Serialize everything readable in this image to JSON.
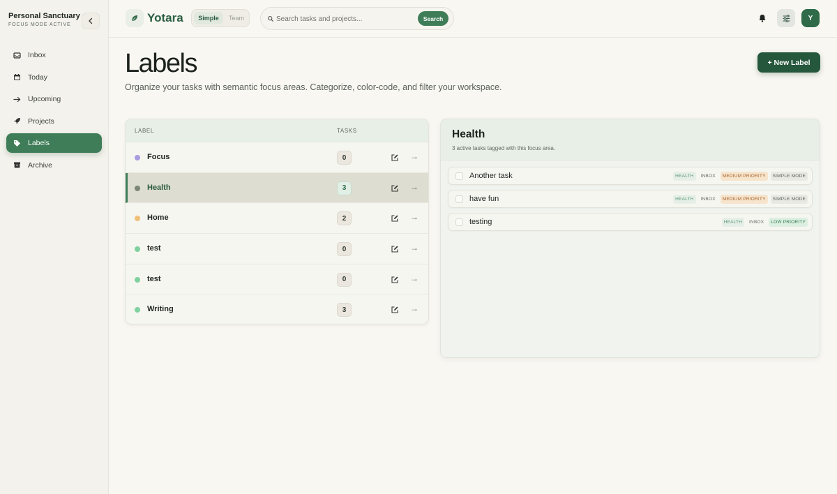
{
  "sidebar": {
    "workspace_name": "Personal Sanctuary",
    "workspace_status": "FOCUS MODE ACTIVE",
    "items": [
      {
        "label": "Inbox",
        "icon": "inbox-icon"
      },
      {
        "label": "Today",
        "icon": "calendar-icon"
      },
      {
        "label": "Upcoming",
        "icon": "arrow-right-icon"
      },
      {
        "label": "Projects",
        "icon": "rocket-icon"
      },
      {
        "label": "Labels",
        "icon": "tag-icon",
        "active": true
      },
      {
        "label": "Archive",
        "icon": "archive-icon"
      }
    ]
  },
  "header": {
    "brand": "Yotara",
    "mode_simple": "Simple",
    "mode_team": "Team",
    "search_placeholder": "Search tasks and projects...",
    "search_button": "Search",
    "avatar_initial": "Y"
  },
  "main": {
    "title": "Labels",
    "subtitle": "Organize your tasks with semantic focus areas. Categorize, color-code, and filter your workspace.",
    "new_label_button": "+ New Label",
    "table": {
      "col_label": "LABEL",
      "col_tasks": "TASKS",
      "rows": [
        {
          "name": "Focus",
          "count": "0",
          "color": "#a99be0"
        },
        {
          "name": "Health",
          "count": "3",
          "color": "#7d8779",
          "selected": true
        },
        {
          "name": "Home",
          "count": "2",
          "color": "#efc07a"
        },
        {
          "name": "test",
          "count": "0",
          "color": "#7fd1a0"
        },
        {
          "name": "test",
          "count": "0",
          "color": "#7fd1a0"
        },
        {
          "name": "Writing",
          "count": "3",
          "color": "#7fd1a0"
        }
      ]
    },
    "detail": {
      "title": "Health",
      "subtitle": "3 active tasks tagged with this focus area.",
      "tasks": [
        {
          "title": "Another task",
          "tags": [
            {
              "text": "HEALTH",
              "kind": "health"
            },
            {
              "text": "INBOX",
              "kind": "inbox"
            },
            {
              "text": "MEDIUM PRIORITY",
              "kind": "medium"
            },
            {
              "text": "SIMPLE MODE",
              "kind": "mode"
            }
          ]
        },
        {
          "title": "have fun",
          "tags": [
            {
              "text": "HEALTH",
              "kind": "health"
            },
            {
              "text": "INBOX",
              "kind": "inbox"
            },
            {
              "text": "MEDIUM PRIORITY",
              "kind": "medium"
            },
            {
              "text": "SIMPLE MODE",
              "kind": "mode"
            }
          ]
        },
        {
          "title": "testing",
          "tags": [
            {
              "text": "HEALTH",
              "kind": "health"
            },
            {
              "text": "INBOX",
              "kind": "inbox"
            },
            {
              "text": "LOW PRIORITY",
              "kind": "low"
            }
          ]
        }
      ]
    }
  },
  "colors": {
    "accent": "#3f7d58",
    "accent_dark": "#25573c",
    "background": "#f9f7f2"
  }
}
